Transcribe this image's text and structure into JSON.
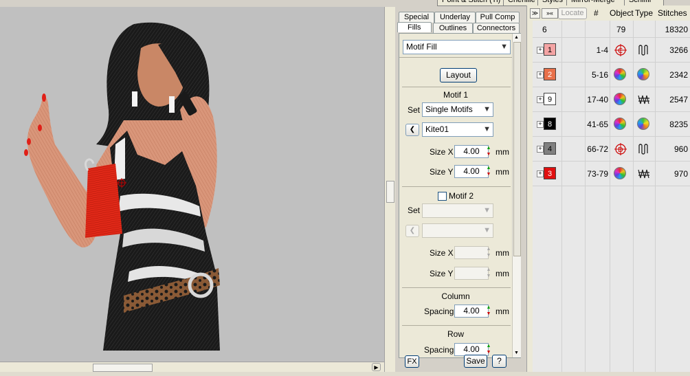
{
  "top_tabs": [
    "Point & Stitch (Ti)",
    "Chenille",
    "Styles",
    "Mirror-Merge",
    "Schiffli"
  ],
  "props": {
    "tabs_row1": [
      "Special",
      "Underlay",
      "Pull Comp"
    ],
    "tabs_row2": [
      "Fills",
      "Outlines",
      "Connectors"
    ],
    "fill_type": "Motif Fill",
    "layout_button": "Layout",
    "motif1": {
      "title": "Motif 1",
      "set_label": "Set",
      "set_value": "Single Motifs",
      "motif_value": "Kite01",
      "size_x_label": "Size X",
      "size_x_value": "4.00",
      "size_y_label": "Size Y",
      "size_y_value": "4.00",
      "unit": "mm"
    },
    "motif2": {
      "title": "Motif 2",
      "set_label": "Set",
      "size_x_label": "Size X",
      "size_y_label": "Size Y",
      "unit": "mm"
    },
    "column": {
      "title": "Column",
      "spacing_label": "Spacing",
      "spacing_value": "4.00",
      "unit": "mm"
    },
    "row": {
      "title": "Row",
      "spacing_label": "Spacing",
      "spacing_value": "4.00"
    },
    "fx_button": "FX",
    "save_button": "Save",
    "help_button": "?"
  },
  "seq": {
    "locate_button": "Locate",
    "headers": {
      "hash": "#",
      "object": "Object",
      "type": "Type",
      "stitches": "Stitches"
    },
    "summary": {
      "colors": "6",
      "objects": "79",
      "stitches": "18320"
    },
    "rows": [
      {
        "color_no": "1",
        "color": "#f4a4a4",
        "range": "1-4",
        "obj_icon": "circle-c-icon",
        "type_icon": "satin-zigzag-icon",
        "stitches": "3266",
        "text_color": "#000000"
      },
      {
        "color_no": "2",
        "color": "#e8704a",
        "range": "5-16",
        "obj_icon": "color-ball-icon",
        "type_icon": "color-ball-icon",
        "stitches": "2342",
        "text_color": "#ffffff"
      },
      {
        "color_no": "9",
        "color": "#ffffff",
        "range": "17-40",
        "obj_icon": "color-ball-icon",
        "type_icon": "tatami-zigzag-icon",
        "stitches": "2547",
        "text_color": "#000000"
      },
      {
        "color_no": "8",
        "color": "#000000",
        "range": "41-65",
        "obj_icon": "color-ball-icon",
        "type_icon": "color-ball-icon",
        "stitches": "8235",
        "text_color": "#ffffff"
      },
      {
        "color_no": "4",
        "color": "#808080",
        "range": "66-72",
        "obj_icon": "circle-d-icon",
        "type_icon": "satin-zigzag-icon",
        "stitches": "960",
        "text_color": "#000000"
      },
      {
        "color_no": "3",
        "color": "#e01010",
        "range": "73-79",
        "obj_icon": "color-ball-icon",
        "type_icon": "tatami-zigzag-icon",
        "stitches": "970",
        "text_color": "#ffffff"
      }
    ]
  }
}
